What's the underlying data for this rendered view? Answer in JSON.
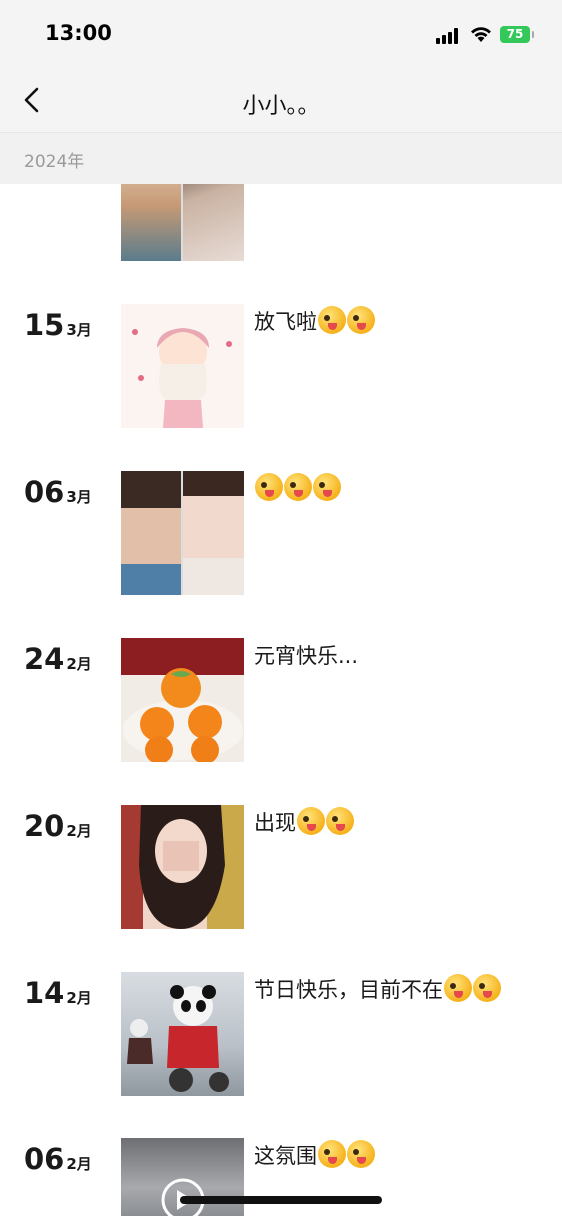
{
  "status": {
    "time": "13:00",
    "battery": "75"
  },
  "nav": {
    "title": "小小。。"
  },
  "year": "2024年",
  "entries": [
    {
      "day": "15",
      "month": "3月",
      "caption": "放飞啦",
      "emoji_count": 2
    },
    {
      "day": "06",
      "month": "3月",
      "caption": "",
      "emoji_count": 3
    },
    {
      "day": "24",
      "month": "2月",
      "caption": "元宵快乐...",
      "emoji_count": 0
    },
    {
      "day": "20",
      "month": "2月",
      "caption": "出现",
      "emoji_count": 2
    },
    {
      "day": "14",
      "month": "2月",
      "caption": "节日快乐，目前不在",
      "emoji_count": 2
    },
    {
      "day": "06",
      "month": "2月",
      "caption": "这氛围",
      "emoji_count": 2
    }
  ],
  "icons": {
    "back": "chevron-left-icon",
    "emoji": "winking-tongue-emoji-icon"
  }
}
